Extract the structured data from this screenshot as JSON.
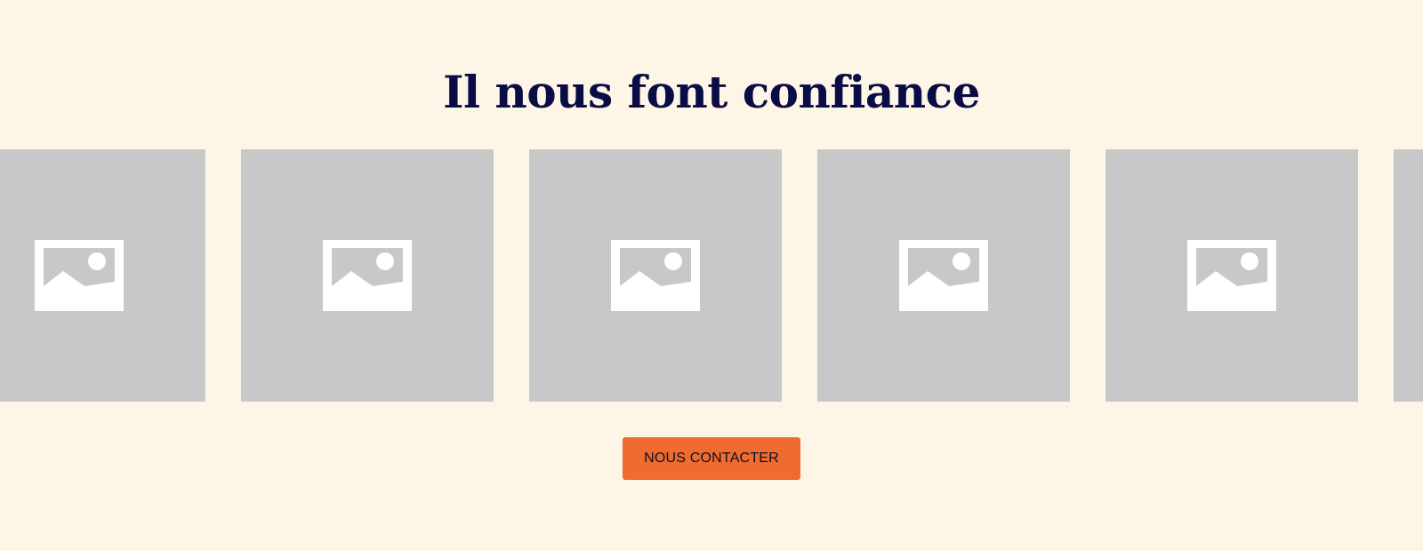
{
  "section": {
    "title": "Il nous font confiance"
  },
  "logos": [
    {
      "icon": "image-placeholder-icon"
    },
    {
      "icon": "image-placeholder-icon"
    },
    {
      "icon": "image-placeholder-icon"
    },
    {
      "icon": "image-placeholder-icon"
    },
    {
      "icon": "image-placeholder-icon"
    },
    {
      "icon": "image-placeholder-icon"
    }
  ],
  "cta": {
    "label": "NOUS CONTACTER"
  },
  "colors": {
    "background": "#fdf6e6",
    "heading": "#0b0c45",
    "placeholder": "#c8c8c8",
    "button": "#ef6b2e"
  }
}
